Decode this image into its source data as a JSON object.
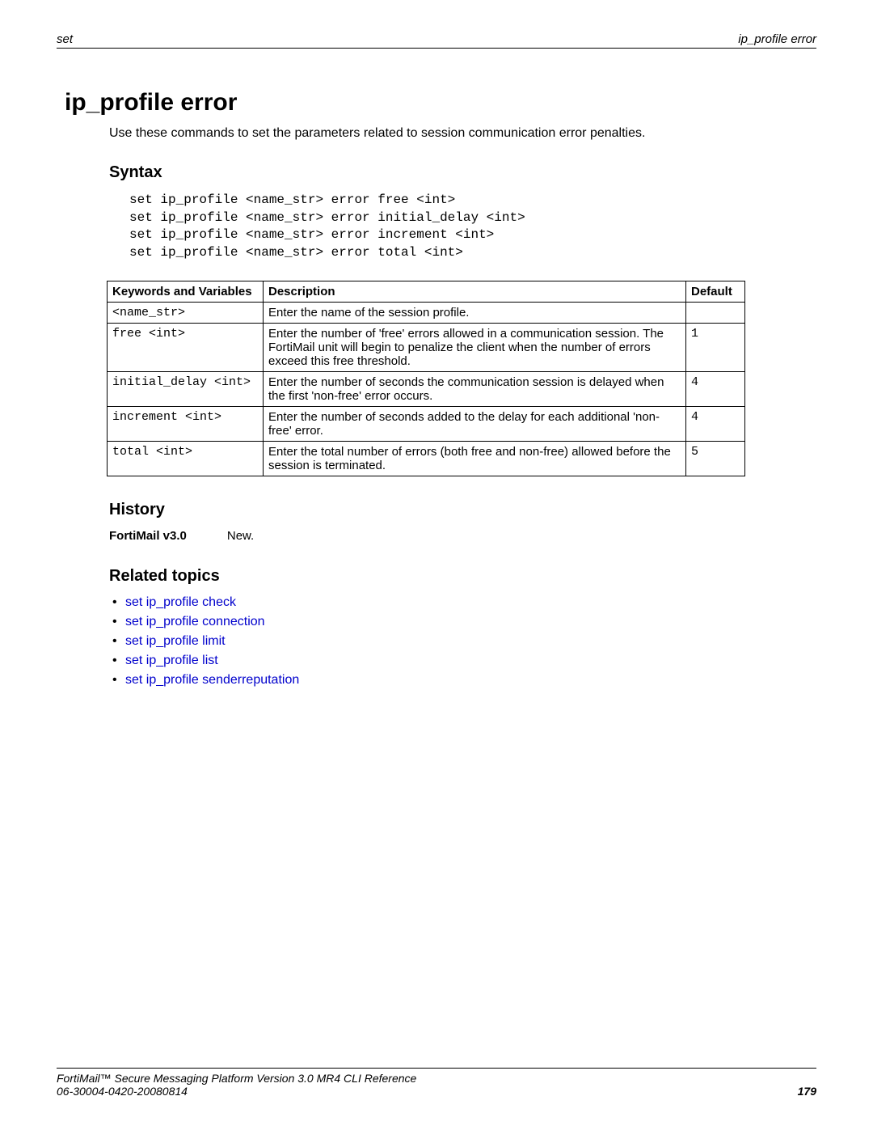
{
  "header": {
    "left": "set",
    "right": "ip_profile error"
  },
  "title": "ip_profile error",
  "intro": "Use these commands to set the parameters related to session communication error penalties.",
  "syntax_heading": "Syntax",
  "syntax_block": "set ip_profile <name_str> error free <int>\nset ip_profile <name_str> error initial_delay <int>\nset ip_profile <name_str> error increment <int>\nset ip_profile <name_str> error total <int>",
  "table": {
    "headers": {
      "kw": "Keywords and Variables",
      "desc": "Description",
      "def": "Default"
    },
    "rows": [
      {
        "kw": "<name_str>",
        "desc": "Enter the name of the session profile.",
        "def": ""
      },
      {
        "kw": "free <int>",
        "desc": "Enter the number of 'free' errors allowed in a communication session. The FortiMail unit will begin to penalize the client when the number of errors exceed this free threshold.",
        "def": "1"
      },
      {
        "kw": "initial_delay <int>",
        "desc": "Enter the number of seconds the communication session is delayed when the first 'non-free' error occurs.",
        "def": "4"
      },
      {
        "kw": "increment <int>",
        "desc": "Enter the number of seconds added to the delay for each additional 'non-free' error.",
        "def": "4"
      },
      {
        "kw": "total <int>",
        "desc": "Enter the total number of errors (both free and non-free) allowed before the session is terminated.",
        "def": "5"
      }
    ]
  },
  "history_heading": "History",
  "history": {
    "version_label": "FortiMail v3.0",
    "status": "New."
  },
  "related_heading": "Related topics",
  "related": [
    "set ip_profile check",
    "set ip_profile connection",
    "set ip_profile limit",
    "set ip_profile list",
    "set ip_profile senderreputation"
  ],
  "footer": {
    "line1": "FortiMail™ Secure Messaging Platform Version 3.0 MR4 CLI Reference",
    "line2": "06-30004-0420-20080814",
    "page": "179"
  }
}
